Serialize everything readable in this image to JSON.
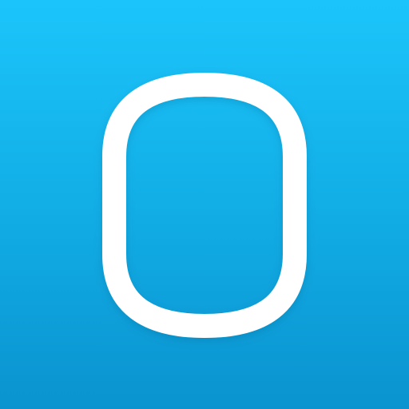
{
  "icon": {
    "glyph": "rounded-outline-shape-icon",
    "colors": {
      "background_top": "#1bc5fb",
      "background_middle": "#12aee6",
      "background_bottom": "#0a93cf",
      "glyph_stroke": "#ffffff"
    }
  }
}
